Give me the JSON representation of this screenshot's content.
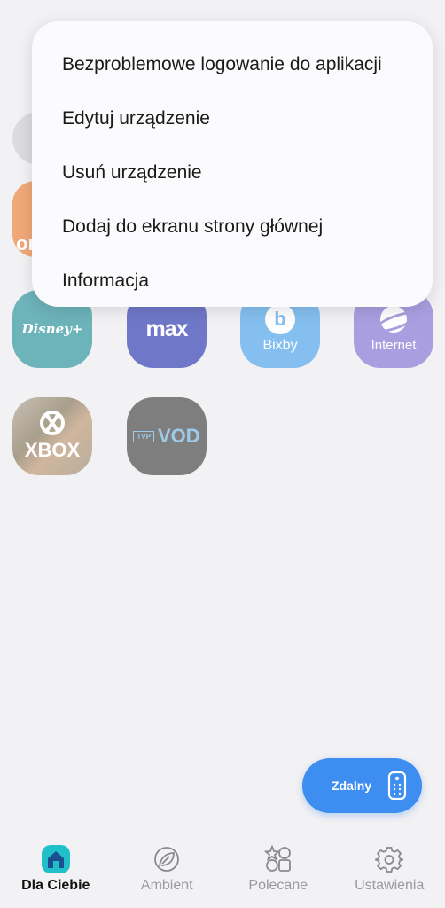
{
  "context_menu": {
    "items": [
      {
        "label": "Bezproblemowe logowanie do aplikacji"
      },
      {
        "label": "Edytuj urządzenie"
      },
      {
        "label": "Usuń urządzenie"
      },
      {
        "label": "Dodaj do ekranu strony głównej"
      },
      {
        "label": "Informacja"
      }
    ]
  },
  "apps": {
    "disney": {
      "label": "Disney+"
    },
    "max": {
      "label": "max"
    },
    "bixby": {
      "label": "Bixby",
      "mark": "b"
    },
    "internet": {
      "label": "Internet"
    },
    "xbox": {
      "label": "XBOX"
    },
    "tvpvod": {
      "tvp": "TVP",
      "vod": "VOD"
    },
    "partial_tile_text": "or"
  },
  "remote_button": {
    "label": "Zdalny",
    "icon": "remote-control-icon"
  },
  "bottom_nav": {
    "items": [
      {
        "label": "Dla Ciebie",
        "icon": "home-icon",
        "active": true
      },
      {
        "label": "Ambient",
        "icon": "leaf-icon",
        "active": false
      },
      {
        "label": "Polecane",
        "icon": "shapes-icon",
        "active": false
      },
      {
        "label": "Ustawienia",
        "icon": "gear-icon",
        "active": false
      }
    ]
  },
  "colors": {
    "accent": "#3d8ef0",
    "home_icon_fill": "#2f8fd8",
    "home_icon_bg": "#1fc0c9"
  }
}
